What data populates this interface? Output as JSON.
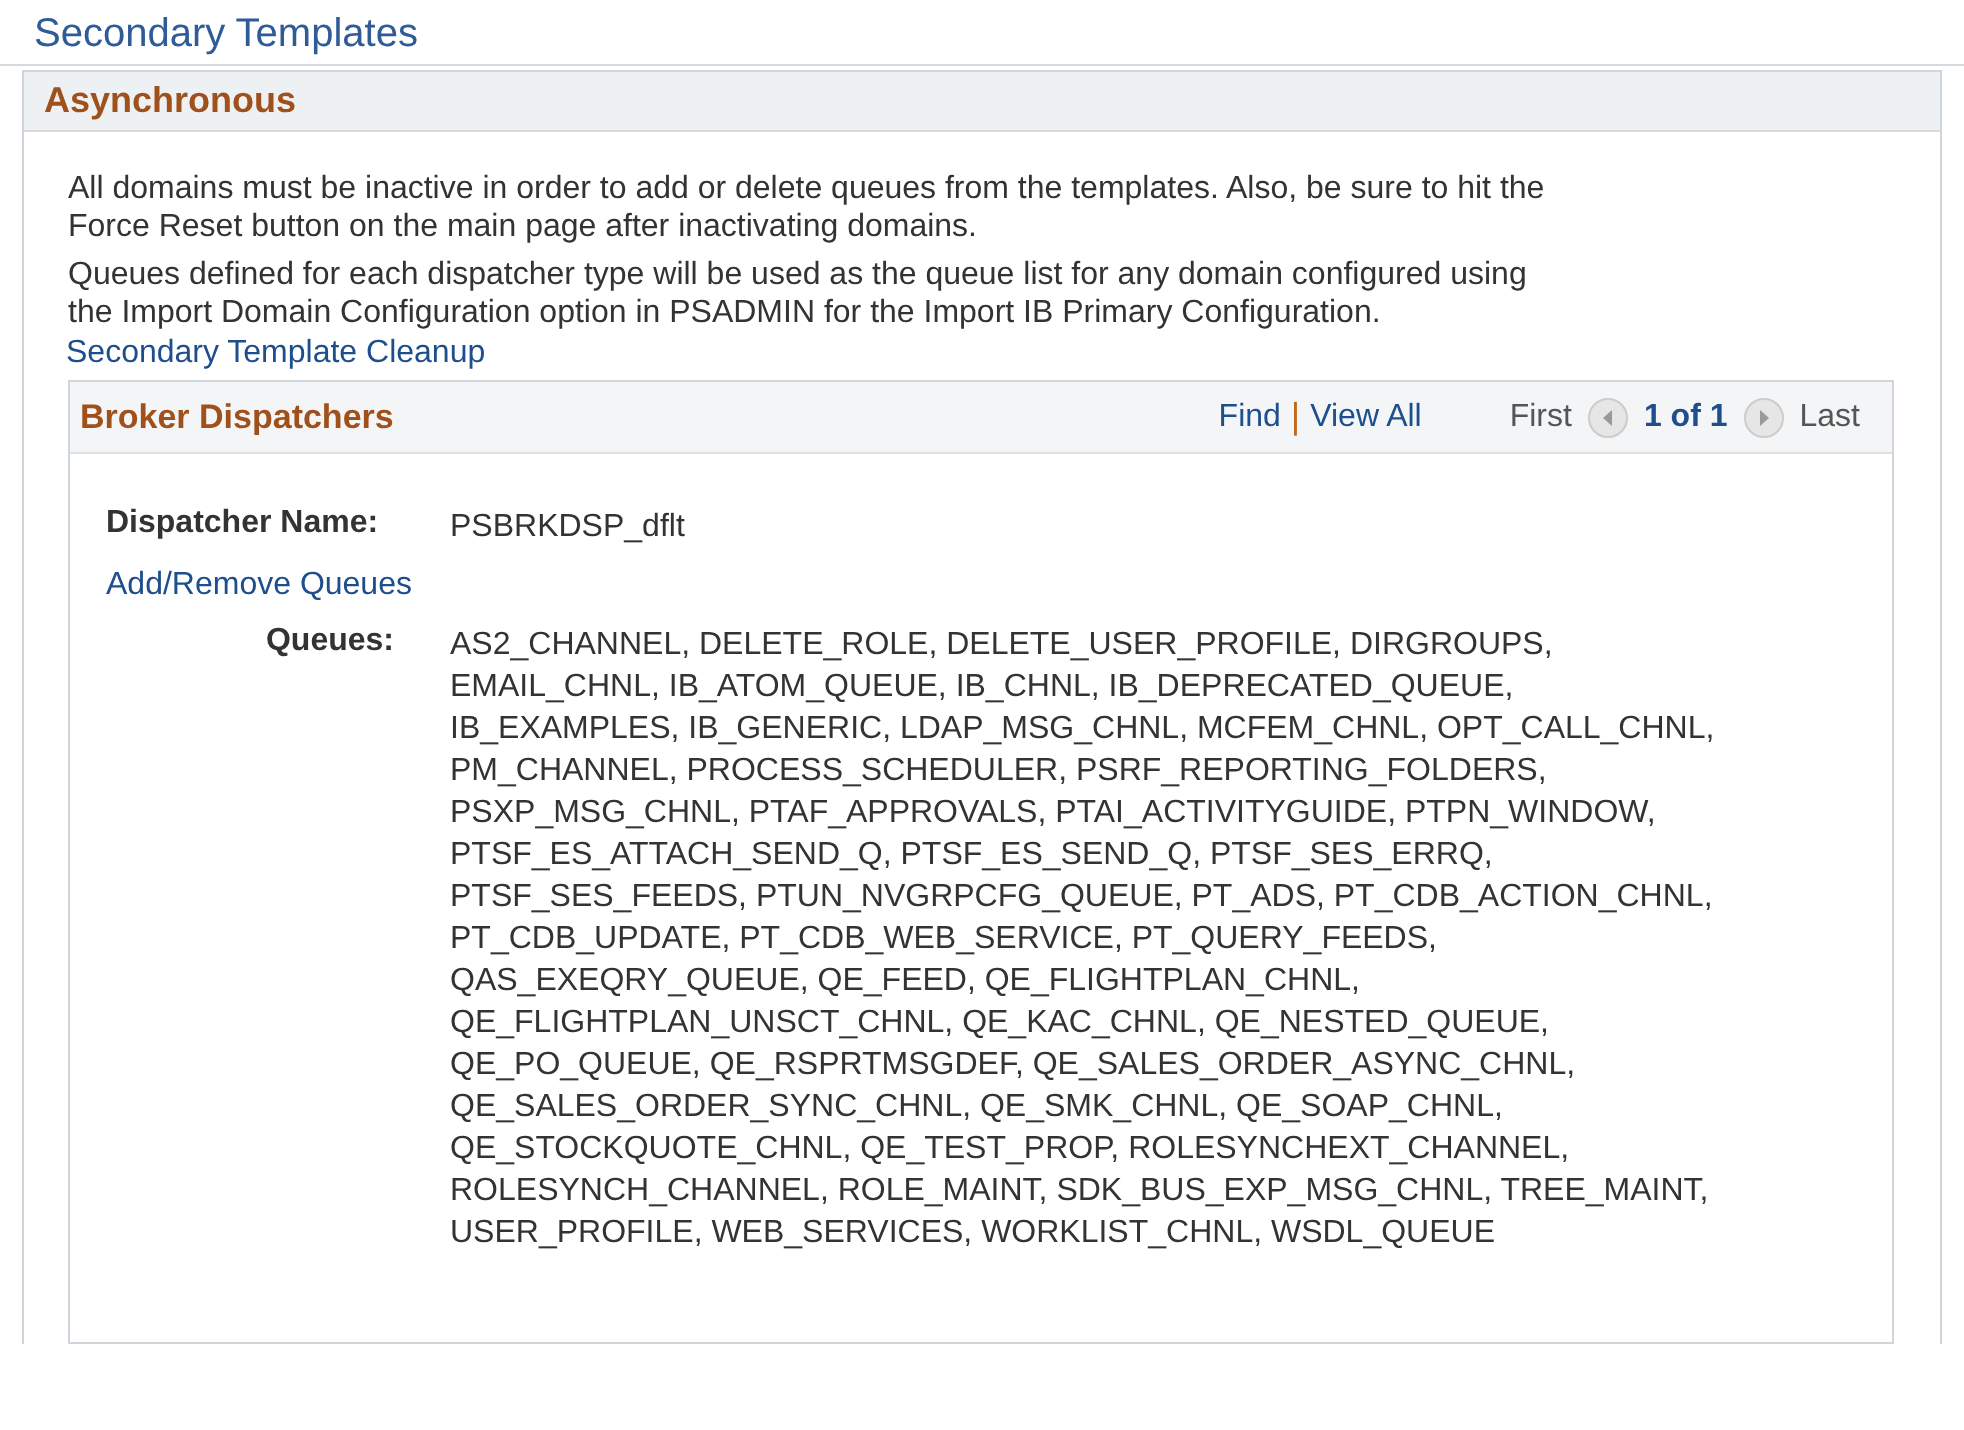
{
  "page_title": "Secondary Templates",
  "section": {
    "title": "Asynchronous",
    "paragraphs": [
      "All domains must be inactive in order to add or delete queues from the templates.  Also, be sure to hit the Force Reset button on the main page after inactivating domains.",
      "Queues defined for each dispatcher type will be used as the queue list for any domain configured using the Import Domain Configuration option in PSADMIN for the Import IB Primary Configuration."
    ],
    "link": "Secondary Template Cleanup"
  },
  "grid": {
    "title": "Broker Dispatchers",
    "find": "Find",
    "separator": "|",
    "view_all": "View All",
    "first": "First",
    "counter": "1 of 1",
    "last": "Last",
    "fields": [
      {
        "kind": "value",
        "label": "Dispatcher Name:",
        "value": "PSBRKDSP_dflt"
      },
      {
        "kind": "link",
        "text": "Add/Remove Queues"
      },
      {
        "kind": "value",
        "label": "Queues:",
        "value": "AS2_CHANNEL, DELETE_ROLE, DELETE_USER_PROFILE, DIRGROUPS, EMAIL_CHNL, IB_ATOM_QUEUE, IB_CHNL, IB_DEPRECATED_QUEUE, IB_EXAMPLES, IB_GENERIC, LDAP_MSG_CHNL, MCFEM_CHNL, OPT_CALL_CHNL, PM_CHANNEL, PROCESS_SCHEDULER, PSRF_REPORTING_FOLDERS, PSXP_MSG_CHNL, PTAF_APPROVALS, PTAI_ACTIVITYGUIDE, PTPN_WINDOW, PTSF_ES_ATTACH_SEND_Q, PTSF_ES_SEND_Q, PTSF_SES_ERRQ, PTSF_SES_FEEDS, PTUN_NVGRPCFG_QUEUE, PT_ADS, PT_CDB_ACTION_CHNL, PT_CDB_UPDATE, PT_CDB_WEB_SERVICE, PT_QUERY_FEEDS, QAS_EXEQRY_QUEUE, QE_FEED, QE_FLIGHTPLAN_CHNL, QE_FLIGHTPLAN_UNSCT_CHNL, QE_KAC_CHNL, QE_NESTED_QUEUE, QE_PO_QUEUE, QE_RSPRTMSGDEF, QE_SALES_ORDER_ASYNC_CHNL, QE_SALES_ORDER_SYNC_CHNL, QE_SMK_CHNL, QE_SOAP_CHNL, QE_STOCKQUOTE_CHNL, QE_TEST_PROP, ROLESYNCHEXT_CHANNEL, ROLESYNCH_CHANNEL, ROLE_MAINT, SDK_BUS_EXP_MSG_CHNL, TREE_MAINT, USER_PROFILE, WEB_SERVICES, WORKLIST_CHNL, WSDL_QUEUE"
      }
    ]
  }
}
